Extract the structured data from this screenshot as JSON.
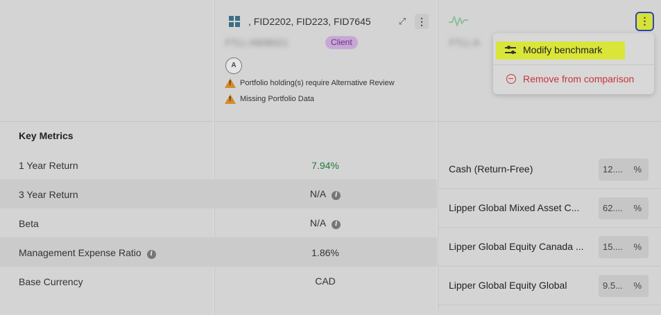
{
  "header": {
    "fund_codes": ", FID2202, FID223, FID7645",
    "blurred_name": "FTLL-AB0B0Z1",
    "client_badge": "Client",
    "avatar_initial": "A",
    "warnings": [
      "Portfolio holding(s) require Alternative Review",
      "Missing Portfolio Data"
    ],
    "right_blurred_name": "FTLL-A"
  },
  "menu": {
    "modify_label": "Modify benchmark",
    "remove_label": "Remove from comparison"
  },
  "metrics": {
    "section_title": "Key Metrics",
    "rows": [
      {
        "label": "1 Year Return",
        "value": "7.94%"
      },
      {
        "label": "3 Year Return",
        "value": "N/A"
      },
      {
        "label": "Beta",
        "value": "N/A"
      },
      {
        "label": "Management Expense Ratio",
        "value": "1.86%"
      },
      {
        "label": "Base Currency",
        "value": "CAD"
      }
    ]
  },
  "benchmark": {
    "rows": [
      {
        "label": "Cash (Return-Free)",
        "value": "12....",
        "unit": "%"
      },
      {
        "label": "Lipper Global Mixed Asset C...",
        "value": "62....",
        "unit": "%"
      },
      {
        "label": "Lipper Global Equity Canada ...",
        "value": "15....",
        "unit": "%"
      },
      {
        "label": "Lipper Global Equity Global",
        "value": "9.5...",
        "unit": "%"
      }
    ]
  },
  "colors": {
    "highlight": "#d9e639",
    "remove_red": "#c9333a",
    "positive_green": "#1e7a3a",
    "client_badge_bg": "#c7a8d4",
    "warning_orange": "#d4892a"
  }
}
